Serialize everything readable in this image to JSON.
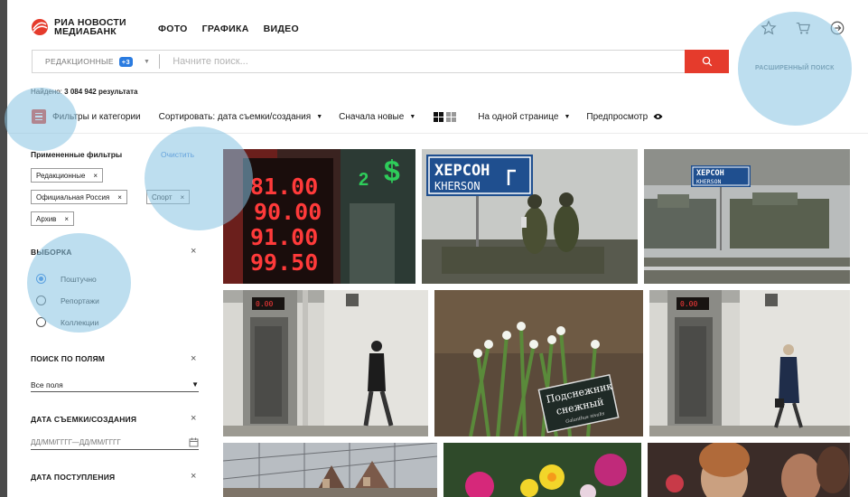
{
  "brand": {
    "line1": "РИА НОВОСТИ",
    "line2": "МЕДИАБАНК"
  },
  "nav": [
    "ФОТО",
    "ГРАФИКА",
    "ВИДЕО"
  ],
  "header_icons": [
    "star-icon",
    "cart-icon",
    "logout-icon"
  ],
  "search": {
    "source_label": "РЕДАКЦИОННЫЕ",
    "source_badge": "+3",
    "placeholder": "Начните поиск...",
    "advanced_label": "РАСШИРЕННЫЙ ПОИСК"
  },
  "results": {
    "label": "Найдено:",
    "count": "3 084 942 результата"
  },
  "toolbar": {
    "filters_label": "Фильтры и категории",
    "sort_label": "Сортировать: дата съемки/создания",
    "order_label": "Сначала новые",
    "per_page_label": "На одной странице",
    "preview_label": "Предпросмотр"
  },
  "sidebar": {
    "applied_title": "Примененные фильтры",
    "clear_label": "Очистить",
    "chips": [
      "Редакционные",
      "Официальная Россия",
      "Спорт",
      "Архив"
    ],
    "selection": {
      "title": "ВЫБОРКА",
      "options": [
        "Поштучно",
        "Репортажи",
        "Коллекции"
      ],
      "selected": "Поштучно"
    },
    "field_search": {
      "title": "ПОИСК ПО ПОЛЯМ",
      "value": "Все поля"
    },
    "shoot_date": {
      "title": "ДАТА СЪЕМКИ/СОЗДАНИЯ",
      "placeholder": "ДД/ММ/ГГГГ—ДД/ММ/ГГГГ"
    },
    "arrival_date": {
      "title": "ДАТА ПОСТУПЛЕНИЯ"
    }
  },
  "photos": {
    "exchange_board": [
      "81.00",
      "90.00",
      "91.00",
      "99.50"
    ],
    "sign_kherson": [
      "ХЕРСОН",
      "KHERSON"
    ],
    "flower_sign": [
      "Подснежник",
      "снежный",
      "Galanthus nivalis"
    ],
    "exchange_small": [
      "0.00",
      "0.00"
    ]
  },
  "colors": {
    "accent": "#e53b2c",
    "link": "#3a7bd5",
    "badge": "#2a7be0",
    "highlight": "#87c3e1"
  }
}
